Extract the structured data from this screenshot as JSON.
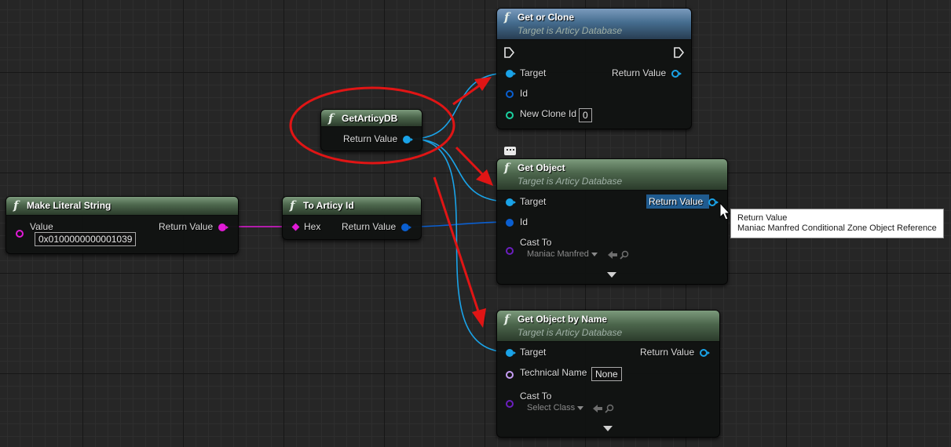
{
  "nodes": {
    "make_literal_string": {
      "title": "Make Literal String",
      "value_label": "Value",
      "value": "0x0100000000001039",
      "return_label": "Return Value"
    },
    "to_articy_id": {
      "title": "To Articy Id",
      "hex_label": "Hex",
      "return_label": "Return Value"
    },
    "get_articy_db": {
      "title": "GetArticyDB",
      "return_label": "Return Value"
    },
    "get_or_clone": {
      "title": "Get or Clone",
      "subtitle": "Target is Articy Database",
      "target_label": "Target",
      "return_label": "Return Value",
      "id_label": "Id",
      "new_clone_id_label": "New Clone Id",
      "new_clone_id_value": "0"
    },
    "get_object": {
      "title": "Get Object",
      "subtitle": "Target is Articy Database",
      "target_label": "Target",
      "return_label": "Return Value",
      "id_label": "Id",
      "cast_to_label": "Cast To",
      "cast_to_value": "Maniac Manfred"
    },
    "get_object_by_name": {
      "title": "Get Object by Name",
      "subtitle": "Target is Articy Database",
      "target_label": "Target",
      "return_label": "Return Value",
      "technical_name_label": "Technical Name",
      "technical_name_value": "None",
      "cast_to_label": "Cast To",
      "cast_to_value": "Select Class"
    }
  },
  "tooltip": {
    "line1": "Return Value",
    "line2": "Maniac Manfred Conditional Zone Object Reference"
  },
  "icons": [
    "function-icon",
    "exec-pin-icon",
    "arrow-left-icon",
    "magnifier-icon",
    "expand-arrow-icon",
    "comment-bubble-icon",
    "mouse-cursor-icon"
  ],
  "colors": {
    "object_pin": "#1aa3e8",
    "struct_pin": "#0a5fd1",
    "string_pin": "#e11ad6",
    "class_pin": "#6b1fbf",
    "name_pin": "#c79ef5",
    "int_pin": "#1bd1a0",
    "annotation_red": "#e01515",
    "pure_header": "#4c664c",
    "call_header": "#456d8f"
  }
}
